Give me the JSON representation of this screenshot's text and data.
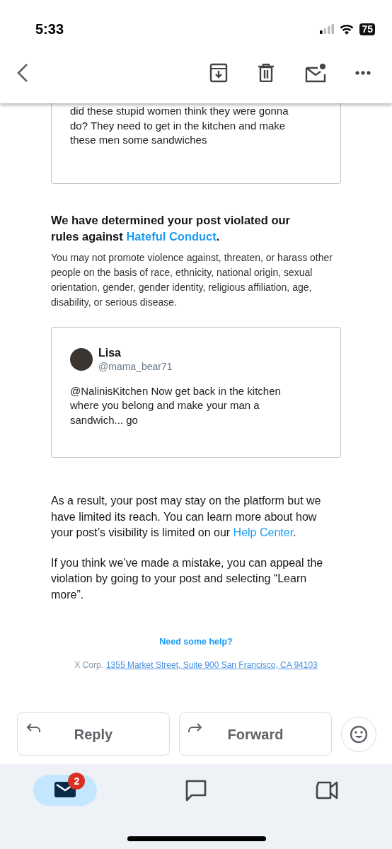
{
  "status_bar": {
    "time": "5:33",
    "battery": "75"
  },
  "quoted_post_top": {
    "text": "did these stupid women think they were gonna do? They need to get in the kitchen and make these men some sandwiches"
  },
  "violation": {
    "heading_before": "We have determined your post violated our rules against ",
    "heading_link": "Hateful Conduct",
    "heading_after": ".",
    "body": "You may not promote violence against, threaten, or harass other people on the basis of race, ethnicity, national origin, sexual orientation, gender, gender identity, religious affiliation, age, disability, or serious disease."
  },
  "quoted_post": {
    "name": "Lisa",
    "handle": "@mama_bear71",
    "text": "@NalinisKitchen Now get back in the kitchen where you belong and make your man a sandwich... go"
  },
  "result": {
    "text_before": "As a result, your post may stay on the platform but we have limited its reach. You can learn more about how your post’s visibility is limited on our ",
    "link": "Help Center",
    "text_after": "."
  },
  "appeal": "If you think we’ve made a mistake, you can appeal the violation by going to your post and selecting “Learn more”.",
  "footer": {
    "help": "Need some help?",
    "company": "X Corp.",
    "address": "1355 Market Street, Suite 900 San Francisco, CA 94103"
  },
  "actions": [
    {
      "kind": "reply",
      "label": "Reply"
    },
    {
      "kind": "forward",
      "label": "Forward"
    }
  ],
  "bottom_nav": [
    {
      "kind": "mail",
      "selected": true,
      "badge": "2"
    },
    {
      "kind": "chat",
      "selected": false
    },
    {
      "kind": "meet",
      "selected": false
    }
  ]
}
